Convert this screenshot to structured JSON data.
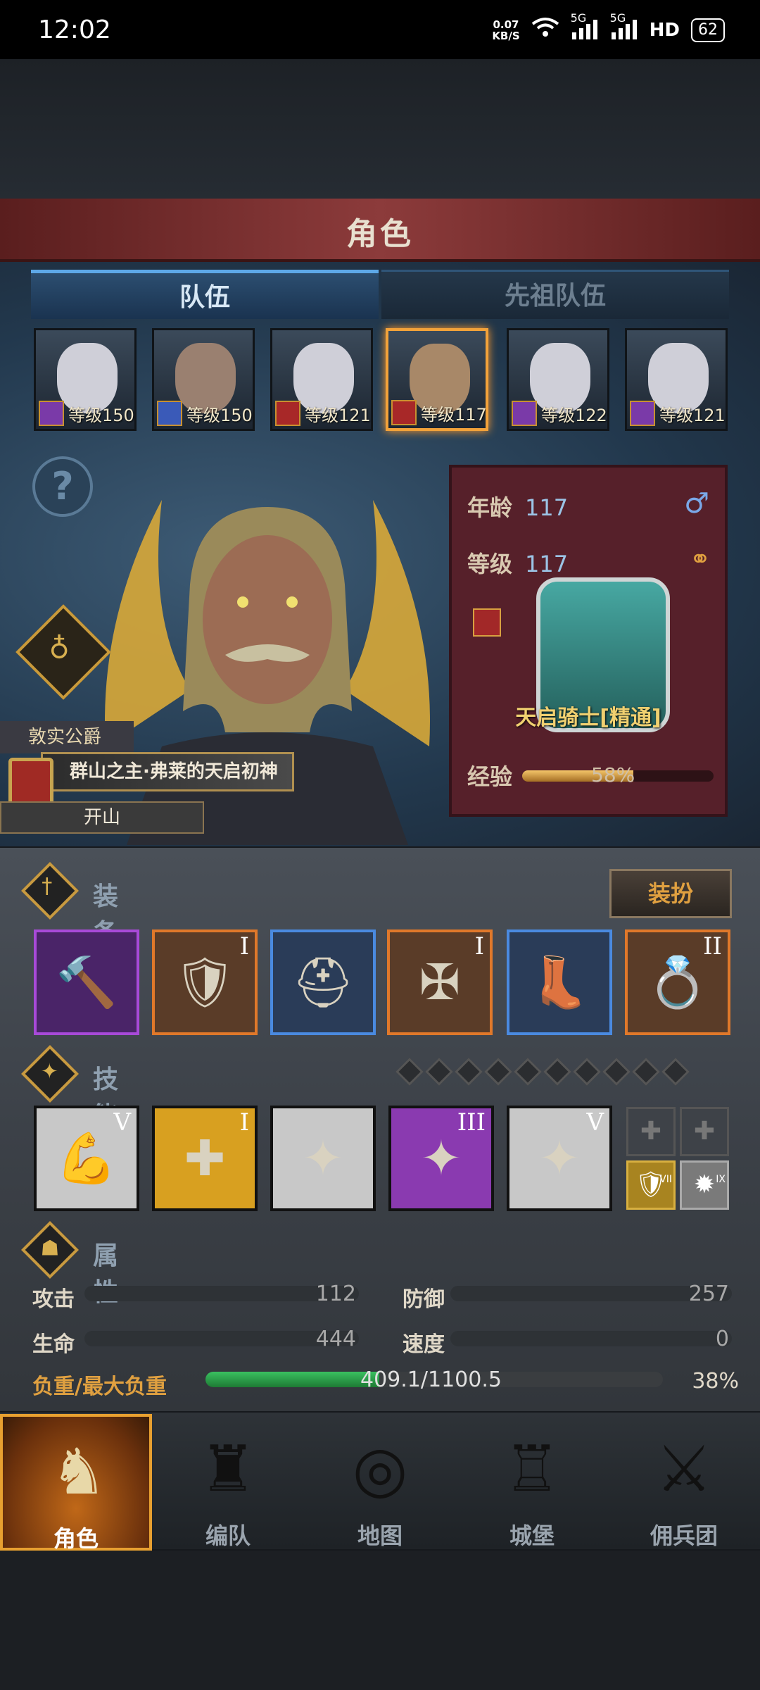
{
  "status_bar": {
    "time": "12:02",
    "net_speed_value": "0.07",
    "net_speed_unit": "KB/S",
    "signal1": "5G",
    "signal2": "5G",
    "hd": "HD",
    "battery": "62"
  },
  "header": {
    "title": "角色"
  },
  "tabs": [
    {
      "label": "队伍",
      "active": true
    },
    {
      "label": "先祖队伍",
      "active": false
    }
  ],
  "party": [
    {
      "level": "等级150",
      "class_color": "#7a3aa8",
      "face": "#cfcfd8",
      "selected": false
    },
    {
      "level": "等级150",
      "class_color": "#3a5ab8",
      "face": "#9a8070",
      "selected": false
    },
    {
      "level": "等级121",
      "class_color": "#a82828",
      "face": "#cfcfd8",
      "selected": false
    },
    {
      "level": "等级117",
      "class_color": "#a82828",
      "face": "#a88868",
      "selected": true
    },
    {
      "level": "等级122",
      "class_color": "#7a3aa8",
      "face": "#cfcfd8",
      "selected": false
    },
    {
      "level": "等级121",
      "class_color": "#7a3aa8",
      "face": "#cfcfd8",
      "selected": false
    }
  ],
  "hero": {
    "title_badge": "敦实公爵",
    "name": "群山之主·弗莱的天启初神",
    "subtitle": "开山"
  },
  "info": {
    "age_label": "年龄",
    "age_value": "117",
    "level_label": "等级",
    "level_value": "117",
    "class_name": "天启骑士[精通]",
    "xp_label": "经验",
    "xp_percent": "58%",
    "xp_fraction": 0.58,
    "gender_icon": "male-icon",
    "ring_icon": "ring-icon"
  },
  "equipment": {
    "label": "装备",
    "dress_button": "装扮",
    "items": [
      {
        "name": "mace",
        "roman": "",
        "border": "#a84ad8",
        "bg": "#4a2468",
        "glyph": "🔨"
      },
      {
        "name": "shield",
        "roman": "I",
        "border": "#e0782a",
        "bg": "#5a3c28",
        "glyph": "🛡"
      },
      {
        "name": "helmet",
        "roman": "",
        "border": "#4a8ae0",
        "bg": "#2a3c58",
        "glyph": "⛑"
      },
      {
        "name": "armor",
        "roman": "I",
        "border": "#e0782a",
        "bg": "#5a3c28",
        "glyph": "✠"
      },
      {
        "name": "boots",
        "roman": "",
        "border": "#4a8ae0",
        "bg": "#2a3c58",
        "glyph": "👢"
      },
      {
        "name": "ring",
        "roman": "II",
        "border": "#e0782a",
        "bg": "#5a3c28",
        "glyph": "💍"
      }
    ]
  },
  "skills": {
    "label": "技能",
    "items": [
      {
        "roman": "V",
        "bg": "#c8c8c8",
        "glyph": "💪"
      },
      {
        "roman": "I",
        "bg": "#d8a020",
        "glyph": "✚"
      },
      {
        "roman": "",
        "bg": "#c8c8c8",
        "glyph": "✦"
      },
      {
        "roman": "III",
        "bg": "#8a3ab0",
        "glyph": "✦"
      },
      {
        "roman": "V",
        "bg": "#c8c8c8",
        "glyph": "✦"
      }
    ],
    "mini": [
      {
        "roman": "VII"
      },
      {
        "roman": "IX"
      }
    ]
  },
  "attributes": {
    "label": "属性",
    "attack_label": "攻击",
    "attack_value": "112",
    "defense_label": "防御",
    "defense_value": "257",
    "life_label": "生命",
    "life_value": "444",
    "speed_label": "速度",
    "speed_value": "0",
    "load_label": "负重/最大负重",
    "load_text": "409.1/1100.5",
    "load_percent": "38%",
    "load_fraction": 0.38
  },
  "nav": [
    {
      "label": "角色",
      "active": true,
      "icon": "knight-icon"
    },
    {
      "label": "编队",
      "active": false,
      "icon": "squad-icon"
    },
    {
      "label": "地图",
      "active": false,
      "icon": "compass-icon"
    },
    {
      "label": "城堡",
      "active": false,
      "icon": "castle-icon"
    },
    {
      "label": "佣兵团",
      "active": false,
      "icon": "mercenary-icon"
    }
  ]
}
